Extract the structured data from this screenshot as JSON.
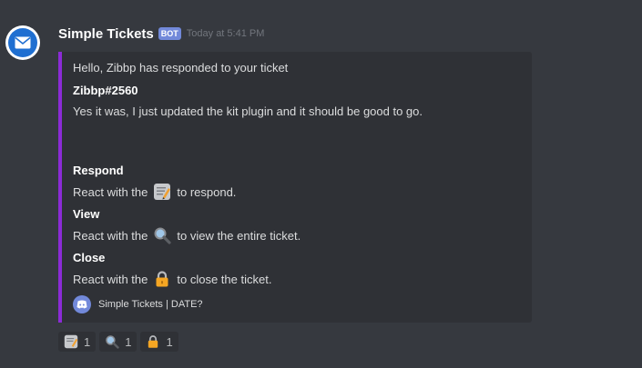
{
  "message": {
    "username": "Simple Tickets",
    "bot_tag": "BOT",
    "timestamp": "Today at 5:41 PM",
    "avatar_icon": "envelope-icon"
  },
  "embed": {
    "accent_color": "#8b2bd6",
    "description": "Hello, Zibbp has responded to your ticket",
    "fields": [
      {
        "name": "Zibbp#2560",
        "value": "Yes it was, I just updated the kit plugin and it should be good to go."
      },
      {
        "name": "Respond",
        "value_prefix": "React with the",
        "emoji": "memo-icon",
        "value_suffix": "to respond."
      },
      {
        "name": "View",
        "value_prefix": "React with the",
        "emoji": "magnifier-icon",
        "value_suffix": "to view the entire ticket."
      },
      {
        "name": "Close",
        "value_prefix": "React with the",
        "emoji": "lock-icon",
        "value_suffix": "to close the ticket."
      }
    ],
    "footer": {
      "icon": "discord-icon",
      "text": "Simple Tickets | DATE?"
    }
  },
  "reactions": [
    {
      "emoji": "memo-icon",
      "count": "1"
    },
    {
      "emoji": "magnifier-icon",
      "count": "1"
    },
    {
      "emoji": "lock-icon",
      "count": "1"
    }
  ]
}
